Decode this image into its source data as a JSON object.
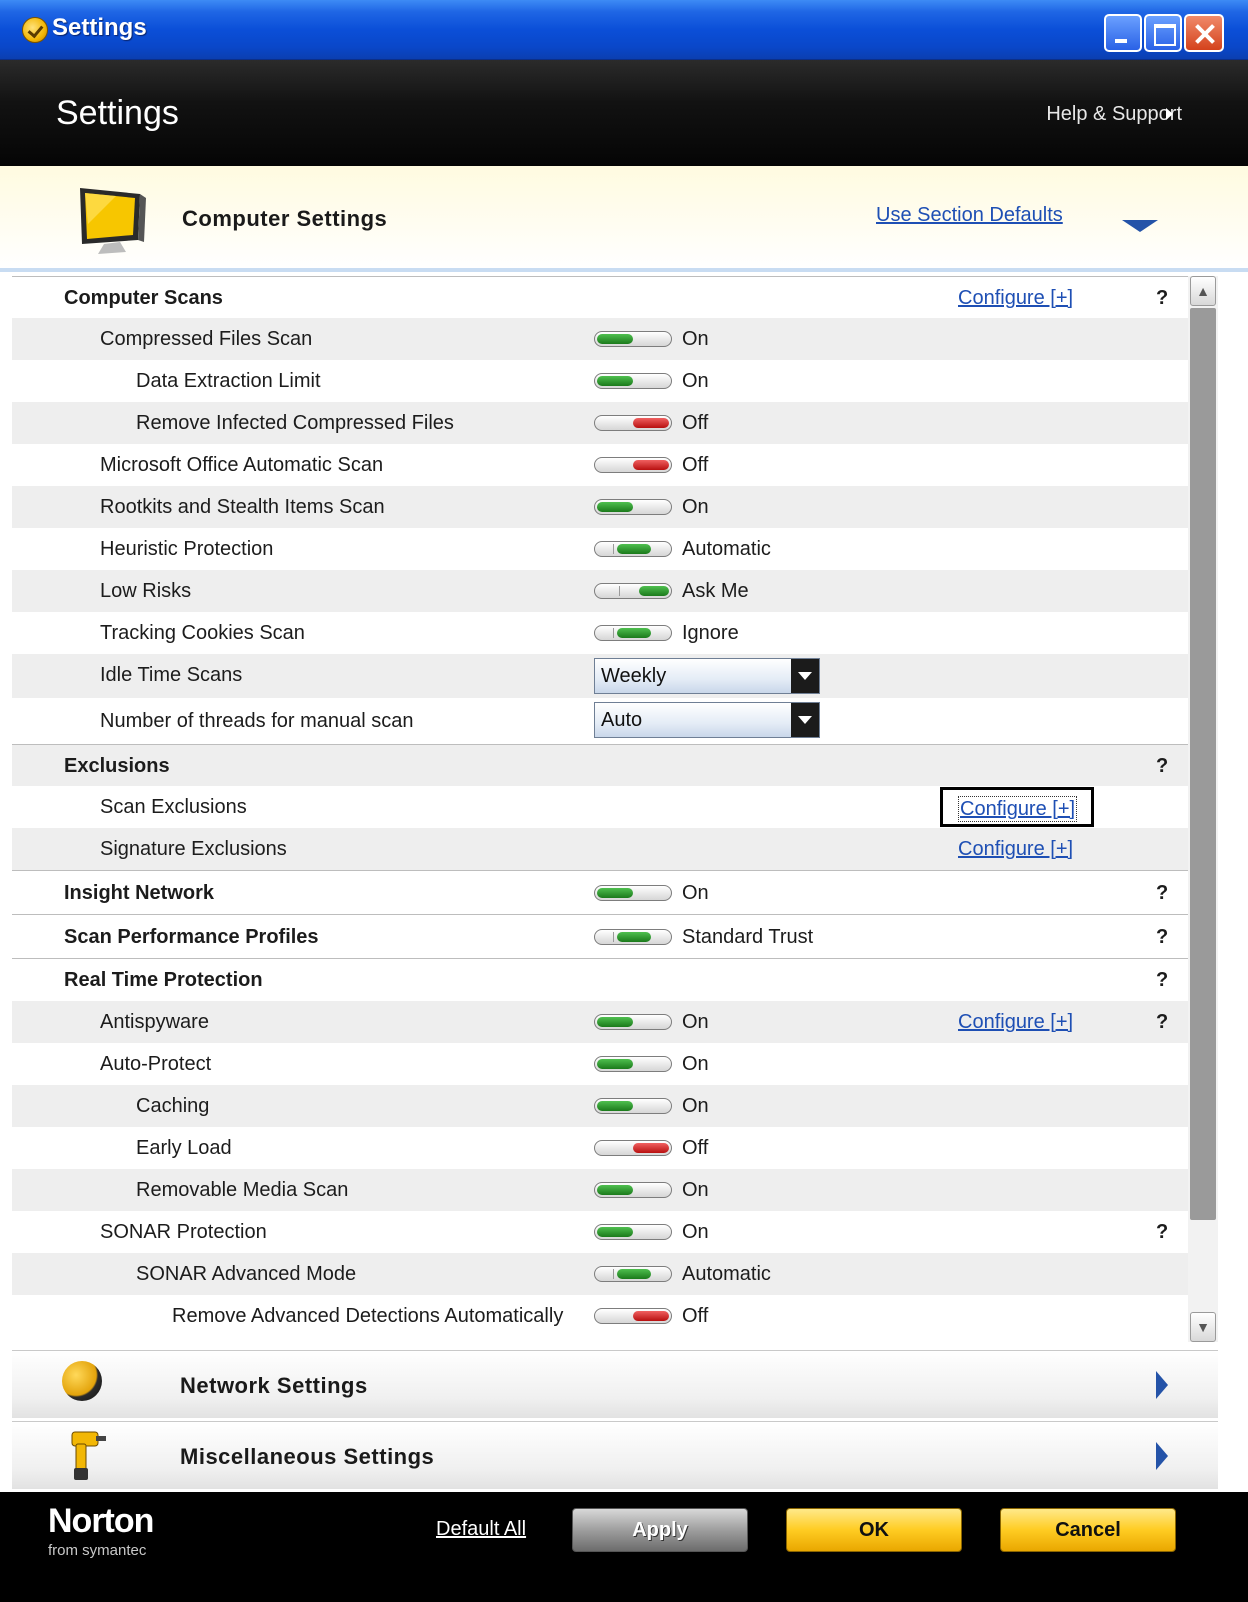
{
  "window": {
    "title": "Settings"
  },
  "header": {
    "title": "Settings",
    "help_label": "Help & Support"
  },
  "section": {
    "title": "Computer Settings",
    "defaults_label": "Use Section Defaults"
  },
  "rows": [
    {
      "label": "Computer Scans",
      "configure": "Configure [+]",
      "help": "?"
    },
    {
      "label": "Compressed Files Scan",
      "state": "On"
    },
    {
      "label": "Data Extraction Limit",
      "state": "On"
    },
    {
      "label": "Remove Infected Compressed Files",
      "state": "Off"
    },
    {
      "label": "Microsoft Office Automatic Scan",
      "state": "Off"
    },
    {
      "label": "Rootkits and Stealth Items Scan",
      "state": "On"
    },
    {
      "label": "Heuristic Protection",
      "state": "Automatic"
    },
    {
      "label": "Low Risks",
      "state": "Ask Me"
    },
    {
      "label": "Tracking Cookies Scan",
      "state": "Ignore"
    },
    {
      "label": "Idle Time Scans",
      "value": "Weekly"
    },
    {
      "label": "Number of threads for manual scan",
      "value": "Auto"
    },
    {
      "label": "Exclusions",
      "help": "?"
    },
    {
      "label": "Scan Exclusions",
      "configure": "Configure [+]"
    },
    {
      "label": "Signature Exclusions",
      "configure": "Configure [+]"
    },
    {
      "label": "Insight Network",
      "state": "On",
      "help": "?"
    },
    {
      "label": "Scan Performance Profiles",
      "state": "Standard Trust",
      "help": "?"
    },
    {
      "label": "Real Time Protection",
      "help": "?"
    },
    {
      "label": "Antispyware",
      "state": "On",
      "configure": "Configure [+]",
      "help": "?"
    },
    {
      "label": "Auto-Protect",
      "state": "On"
    },
    {
      "label": "Caching",
      "state": "On"
    },
    {
      "label": "Early Load",
      "state": "Off"
    },
    {
      "label": "Removable Media Scan",
      "state": "On"
    },
    {
      "label": "SONAR Protection",
      "state": "On",
      "help": "?"
    },
    {
      "label": "SONAR Advanced Mode",
      "state": "Automatic"
    },
    {
      "label": "Remove Advanced Detections Automatically",
      "state": "Off"
    }
  ],
  "collapsed_sections": [
    {
      "title": "Network Settings"
    },
    {
      "title": "Miscellaneous Settings"
    }
  ],
  "footer": {
    "logo": "Norton",
    "logo_sub": "from symantec",
    "default_all": "Default All",
    "apply": "Apply",
    "ok": "OK",
    "cancel": "Cancel"
  },
  "colors": {
    "link": "#1e4fb4",
    "toggle_on": "#1b7a1b",
    "toggle_off": "#b81010",
    "button_yellow": "#ffcc22"
  }
}
